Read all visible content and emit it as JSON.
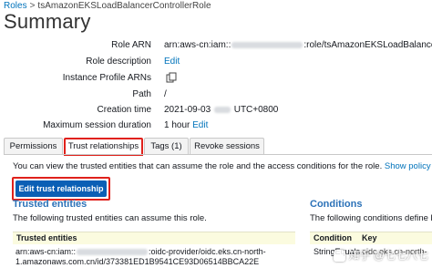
{
  "breadcrumb": {
    "root": "Roles",
    "separator": ">",
    "current": "tsAmazonEKSLoadBalancerControllerRole"
  },
  "title": "Summary",
  "summary": {
    "role_arn": {
      "label": "Role ARN",
      "prefix": "arn:aws-cn:iam::",
      "suffix": ":role/tsAmazonEKSLoadBalancerControllerRole"
    },
    "role_description": {
      "label": "Role description",
      "link": "Edit"
    },
    "instance_profile": {
      "label": "Instance Profile ARNs"
    },
    "path": {
      "label": "Path",
      "value": "/"
    },
    "creation_time": {
      "label": "Creation time",
      "date": "2021-09-03",
      "suffix": "UTC+0800"
    },
    "max_session": {
      "label": "Maximum session duration",
      "value": "1 hour",
      "link": "Edit"
    }
  },
  "tabs": [
    {
      "label": "Permissions",
      "active": false
    },
    {
      "label": "Trust relationships",
      "active": true
    },
    {
      "label": "Tags (1)",
      "active": false
    },
    {
      "label": "Revoke sessions",
      "active": false
    }
  ],
  "trust": {
    "info": "You can view the trusted entities that can assume the role and the access conditions for the role.",
    "policy_link": "Show policy document",
    "edit_button": "Edit trust relationship",
    "entities_title": "Trusted entities",
    "entities_sub": "The following trusted entities can assume this role.",
    "entities_header": "Trusted entities",
    "entity_line1_prefix": "arn:aws-cn:iam::",
    "entity_line1_suffix": ":oidc-provider/oidc.eks.cn-north-",
    "entity_line2": "1.amazonaws.com.cn/id/373381ED1B9541CE93D06514BBCA22E",
    "conditions_title": "Conditions",
    "conditions_sub": "The following conditions define how and",
    "cond_header_condition": "Condition",
    "cond_header_key": "Key",
    "cond_value": "StringEquals",
    "cond_key": "oidc.eks.cn-north-"
  },
  "watermark": "知乎 @七七八七"
}
